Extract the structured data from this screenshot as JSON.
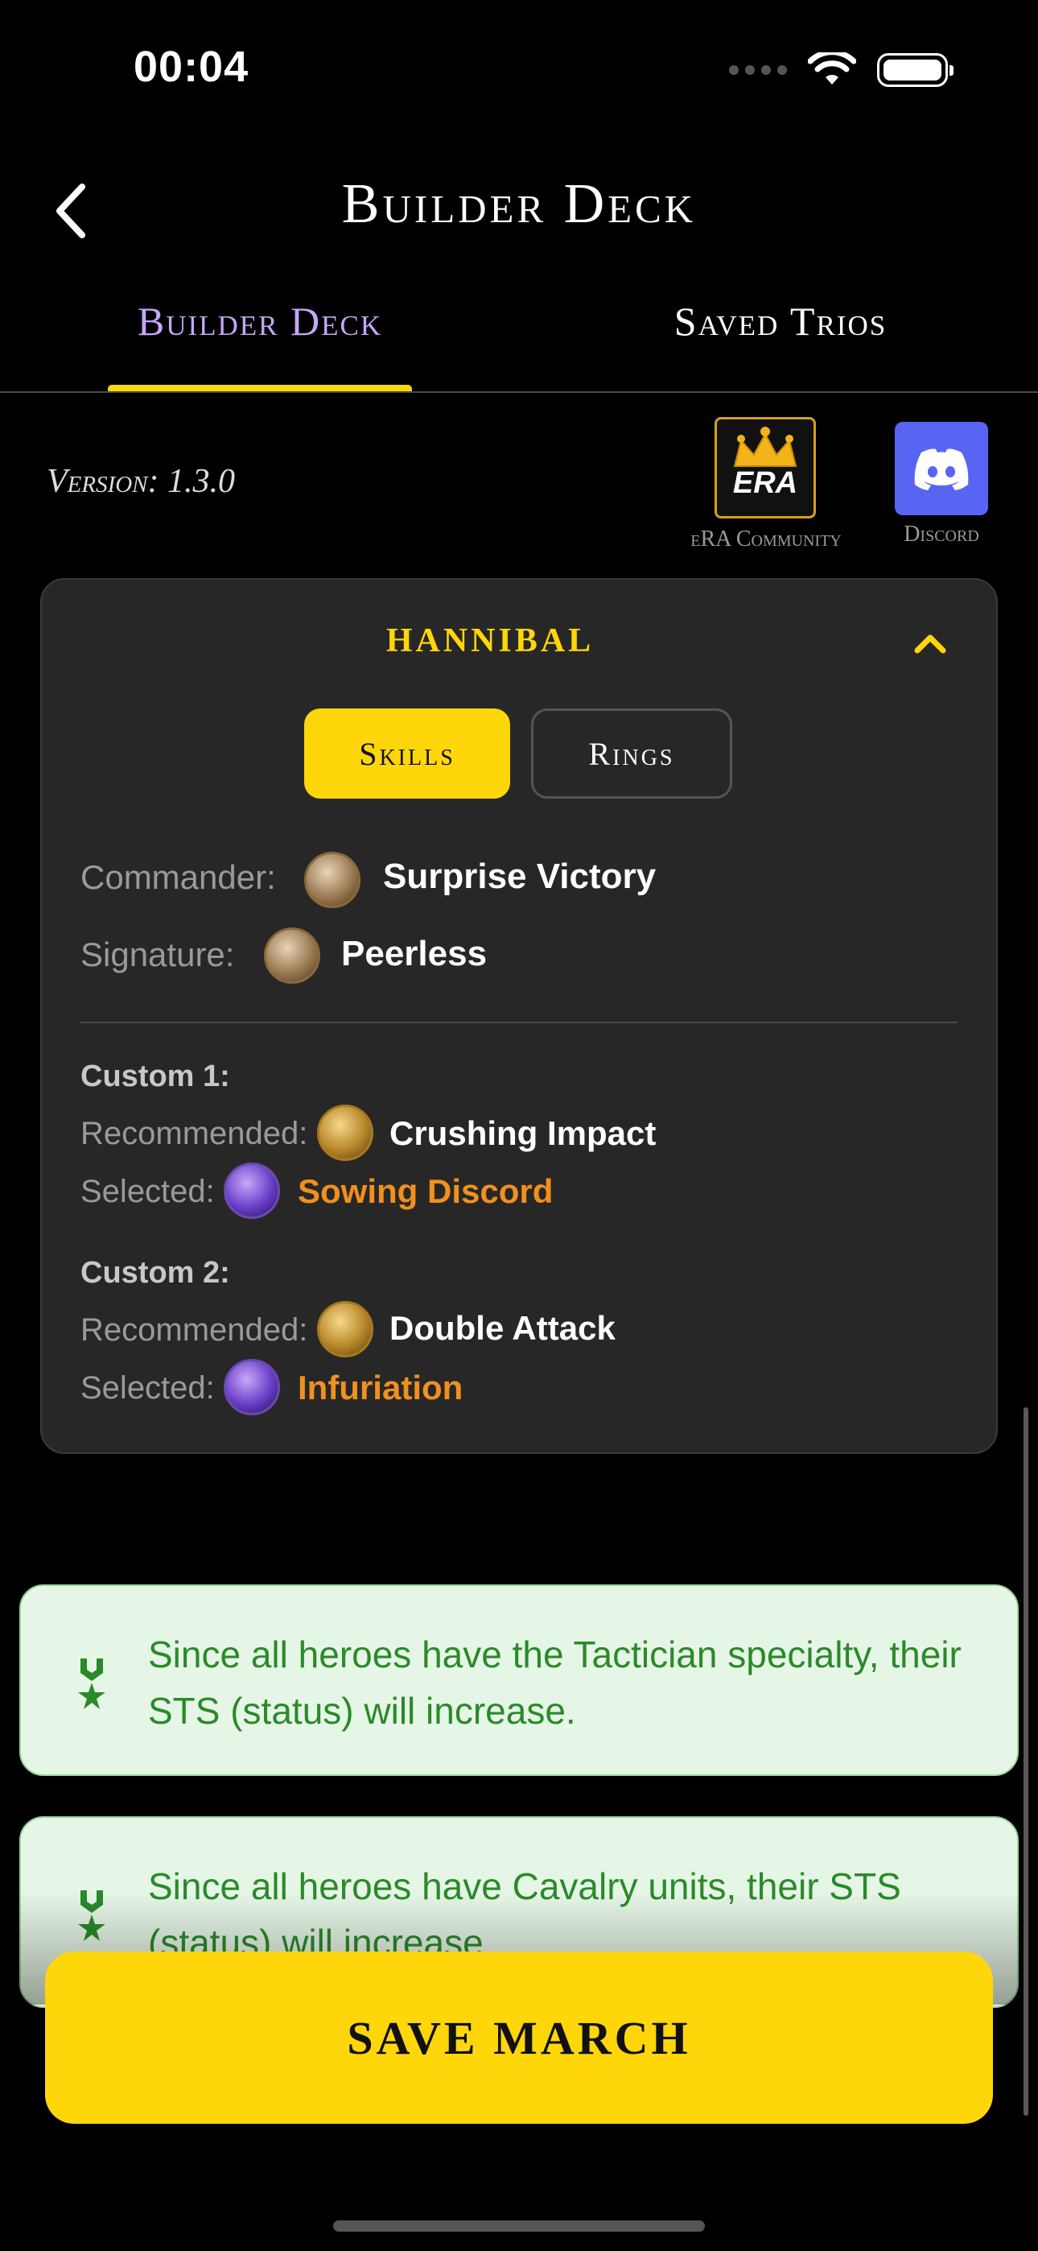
{
  "status_bar": {
    "time": "00:04"
  },
  "nav": {
    "title": "Builder Deck",
    "back_icon": "chevron-left-icon"
  },
  "tabs": [
    {
      "label": "Builder Deck",
      "active": true
    },
    {
      "label": "Saved Trios",
      "active": false
    }
  ],
  "header": {
    "version": "Version: 1.3.0",
    "era": {
      "logo_text": "ERA",
      "label": "eRA Community"
    },
    "discord": {
      "label": "Discord",
      "icon": "discord-icon"
    }
  },
  "hero_card": {
    "name": "HANNIBAL",
    "segments": [
      {
        "label": "Skills",
        "active": true
      },
      {
        "label": "Rings",
        "active": false
      }
    ],
    "commander": {
      "label": "Commander:",
      "value": "Surprise Victory"
    },
    "signature": {
      "label": "Signature:",
      "value": "Peerless"
    },
    "custom1": {
      "heading": "Custom 1:",
      "recommended_label": "Recommended:",
      "recommended": "Crushing Impact",
      "selected_label": "Selected:",
      "selected": "Sowing Discord"
    },
    "custom2": {
      "heading": "Custom 2:",
      "recommended_label": "Recommended:",
      "recommended": "Double Attack",
      "selected_label": "Selected:",
      "selected": "Infuriation"
    }
  },
  "banners": [
    {
      "text": "Since all heroes have the Tactician specialty, their STS (status) will increase.",
      "icon": "medal-icon"
    },
    {
      "text": "Since all heroes have Cavalry units, their STS (status) will increase.",
      "icon": "medal-icon"
    }
  ],
  "save_button": {
    "label": "SAVE MARCH"
  },
  "colors": {
    "accent": "#ffd60a",
    "tab_active": "#c6a6f6",
    "selected_skill": "#f0901e",
    "banner_bg": "#e6f6e6",
    "banner_text": "#2a8a2a",
    "discord": "#5865f2"
  }
}
